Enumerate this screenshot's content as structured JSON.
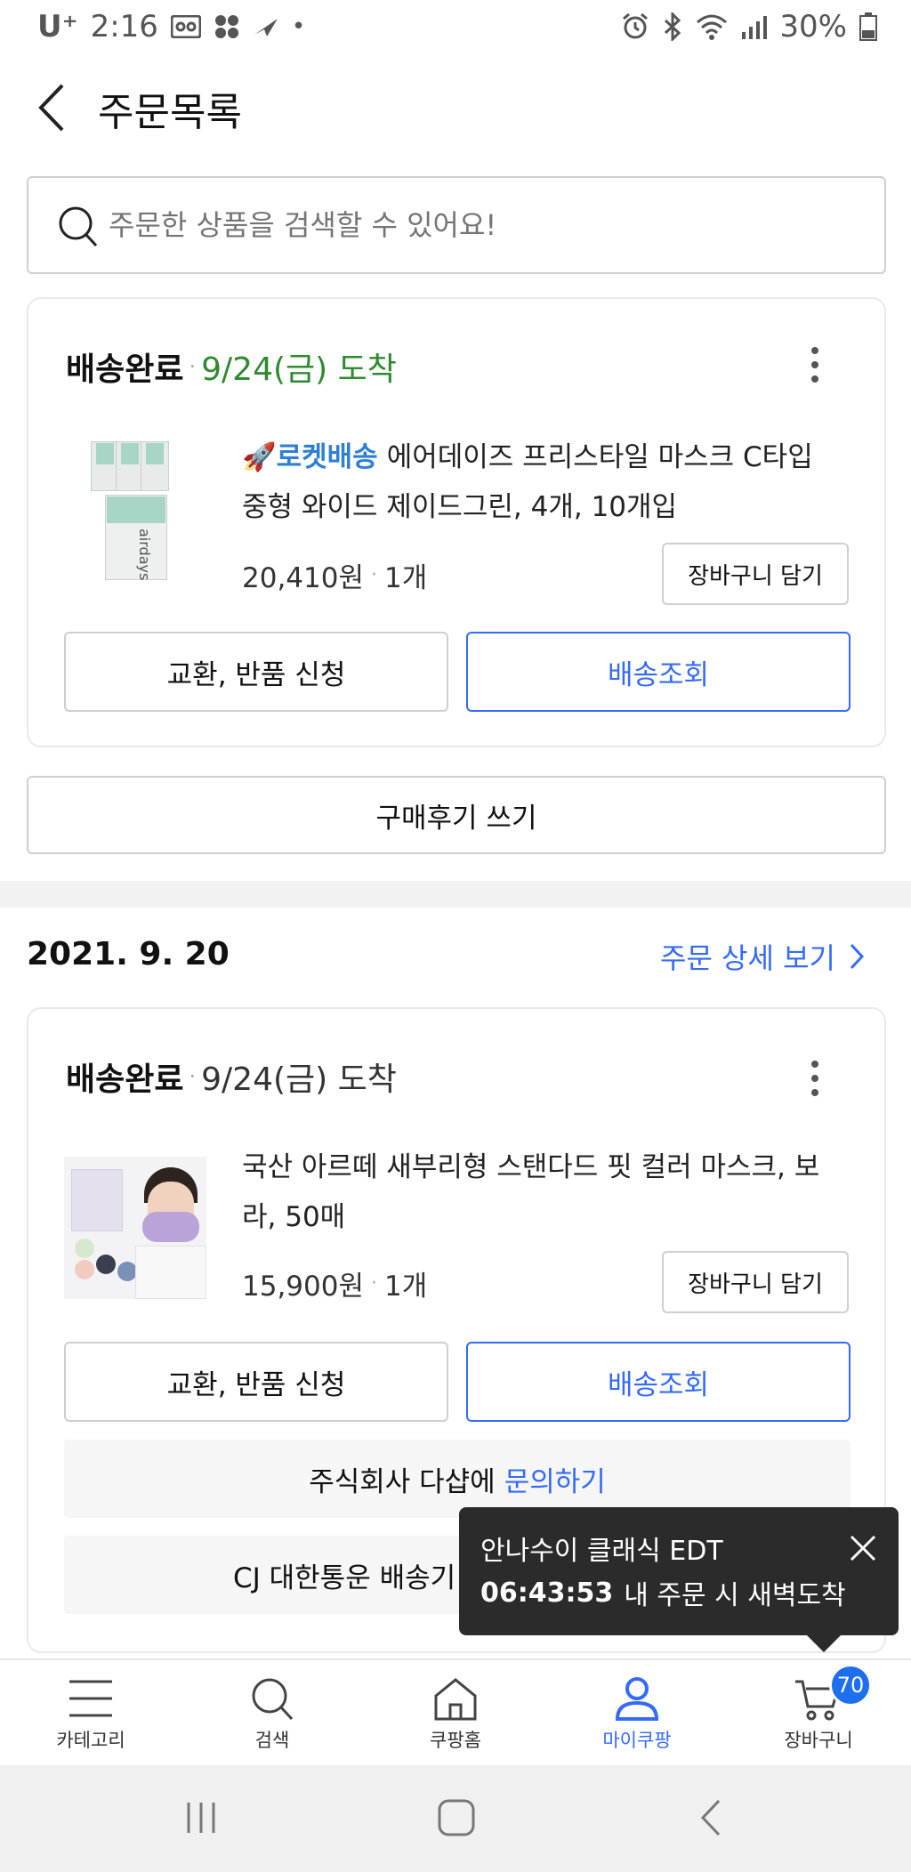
{
  "status_bar": {
    "carrier": "U⁺",
    "time": "2:16",
    "battery": "30%"
  },
  "header": {
    "title": "주문목록"
  },
  "search": {
    "placeholder": "주문한 상품을 검색할 수 있어요!"
  },
  "order1": {
    "status": "배송완료",
    "arrival": "9/24(금) 도착",
    "rocket_label": "로켓배송",
    "product_name_line1": "에어데이즈 프리스타일 마스크 C타입",
    "product_name_line2": "중형 와이드 제이드그린, 4개, 10개입",
    "price": "20,410원",
    "qty": "1개",
    "cart_button": "장바구니 담기",
    "exchange_button": "교환, 반품 신청",
    "track_button": "배송조회",
    "review_button": "구매후기 쓰기",
    "image_text": "airdays"
  },
  "order2": {
    "date": "2021. 9. 20",
    "detail_link": "주문 상세 보기",
    "status": "배송완료",
    "arrival": "9/24(금) 도착",
    "product_name_line1": "국산 아르떼 새부리형 스탠다드 핏 컬러 마스크, 보",
    "product_name_line2": "라, 50매",
    "price": "15,900원",
    "qty": "1개",
    "cart_button": "장바구니 담기",
    "exchange_button": "교환, 반품 신청",
    "track_button": "배송조회",
    "seller_prefix": "주식회사 다샵에",
    "seller_link": "문의하기",
    "courier_text": "CJ 대한통운 배송기"
  },
  "tooltip": {
    "line1": "안나수이 클래식 EDT",
    "timer": "06:43:53",
    "line2": "내 주문 시 새벽도착"
  },
  "bottom_nav": {
    "items": [
      {
        "label": "카테고리",
        "icon": "menu-icon"
      },
      {
        "label": "검색",
        "icon": "search-icon"
      },
      {
        "label": "쿠팡홈",
        "icon": "home-icon"
      },
      {
        "label": "마이쿠팡",
        "icon": "user-icon"
      },
      {
        "label": "장바구니",
        "icon": "cart-icon"
      }
    ],
    "cart_badge": "70",
    "active_color": "#346aff"
  },
  "colors": {
    "green": "#2f8a2f",
    "blue": "#346aff"
  }
}
